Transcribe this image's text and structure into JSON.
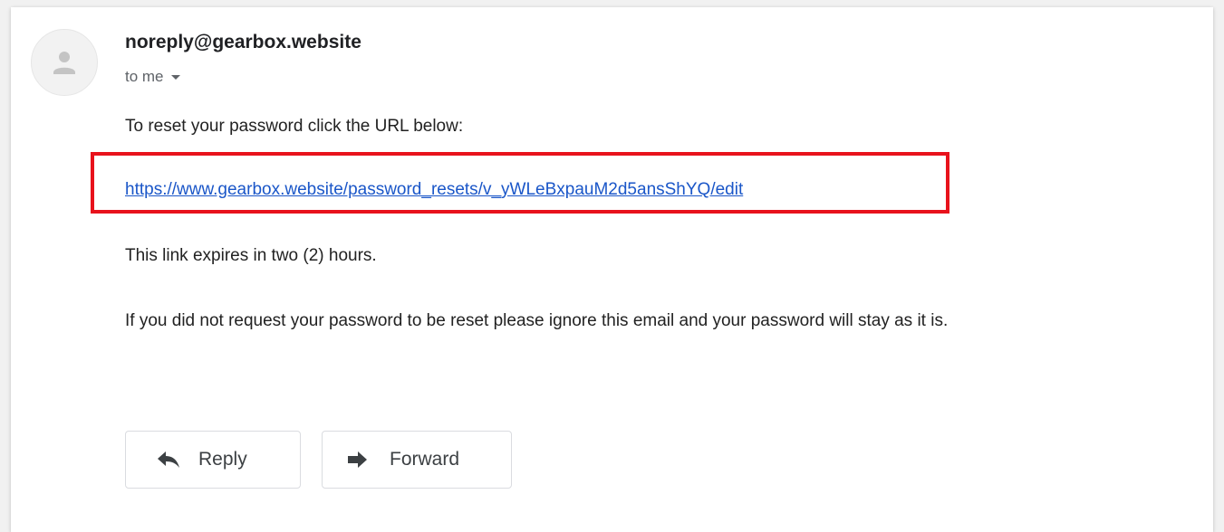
{
  "email": {
    "sender": "noreply@gearbox.website",
    "recipient": "to me",
    "body": {
      "intro": "To reset your password click the URL below:",
      "reset_link": "https://www.gearbox.website/password_resets/v_yWLeBxpauM2d5ansShYQ/edit",
      "expiry": "This link expires in two (2) hours.",
      "disclaimer": "If you did not request your password to be reset please ignore this email and your password will stay as it is."
    },
    "actions": {
      "reply_label": "Reply",
      "forward_label": "Forward"
    }
  },
  "colors": {
    "link": "#1a56c8",
    "highlight_border": "#e8121c"
  },
  "icons": {
    "avatar": "person-icon",
    "recipient_toggle": "caret-down-icon",
    "reply": "reply-arrow-icon",
    "forward": "forward-arrow-icon"
  }
}
